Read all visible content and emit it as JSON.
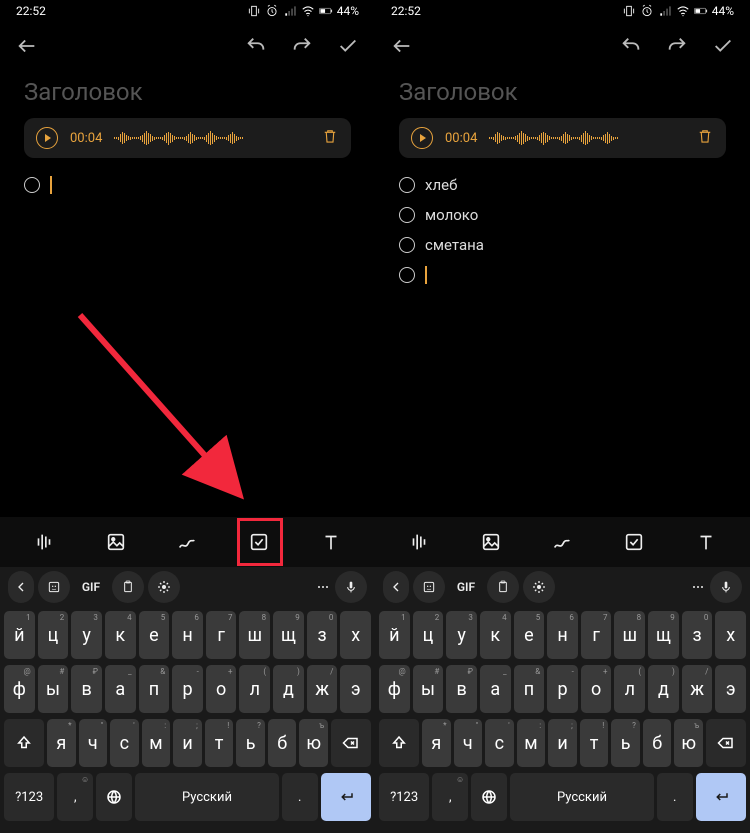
{
  "status": {
    "time": "22:52",
    "battery": "44%"
  },
  "note": {
    "title_placeholder": "Заголовок",
    "audio_time": "00:04"
  },
  "left_screen": {
    "checklist": [
      {
        "text": "",
        "cursor": true
      }
    ]
  },
  "right_screen": {
    "checklist": [
      {
        "text": "хлеб"
      },
      {
        "text": "молоко"
      },
      {
        "text": "сметана"
      },
      {
        "text": "",
        "cursor": true
      }
    ]
  },
  "kb_suggest": {
    "gif": "GIF"
  },
  "keyboard": {
    "row1": [
      {
        "k": "й",
        "s": "1"
      },
      {
        "k": "ц",
        "s": "2"
      },
      {
        "k": "у",
        "s": "3"
      },
      {
        "k": "к",
        "s": "4"
      },
      {
        "k": "е",
        "s": "5"
      },
      {
        "k": "н",
        "s": "6"
      },
      {
        "k": "г",
        "s": "7"
      },
      {
        "k": "ш",
        "s": "8"
      },
      {
        "k": "щ",
        "s": "9"
      },
      {
        "k": "з",
        "s": "0"
      },
      {
        "k": "х",
        "s": ""
      }
    ],
    "row2": [
      {
        "k": "ф",
        "s": "@"
      },
      {
        "k": "ы",
        "s": "#"
      },
      {
        "k": "в",
        "s": "₽"
      },
      {
        "k": "а",
        "s": "_"
      },
      {
        "k": "п",
        "s": "&"
      },
      {
        "k": "р",
        "s": "-"
      },
      {
        "k": "о",
        "s": "+"
      },
      {
        "k": "л",
        "s": "("
      },
      {
        "k": "д",
        "s": ")"
      },
      {
        "k": "ж",
        "s": "/"
      },
      {
        "k": "э",
        "s": ""
      }
    ],
    "row3": [
      {
        "k": "я",
        "s": "*"
      },
      {
        "k": "ч",
        "s": "\""
      },
      {
        "k": "с",
        "s": "'"
      },
      {
        "k": "м",
        "s": ":"
      },
      {
        "k": "и",
        "s": ";"
      },
      {
        "k": "т",
        "s": "!"
      },
      {
        "k": "ь",
        "s": "?"
      },
      {
        "k": "б",
        "s": ""
      },
      {
        "k": "ю",
        "s": "ъ"
      }
    ],
    "sym": "?123",
    "comma": ",",
    "space": "Русский",
    "period": "."
  }
}
